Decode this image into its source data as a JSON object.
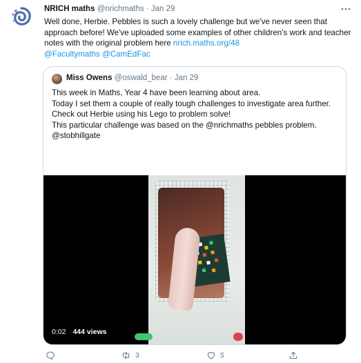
{
  "tweet": {
    "author_name": "NRICH maths",
    "author_handle": "@nrichmaths",
    "separator": " · ",
    "date": "Jan 29",
    "more_icon": "more-horizontal-icon",
    "text_before_link": "Well done, Herbie. Pebbles is such a lovely challenge but we've never seen that approach before! We've uploaded some examples of other children's work and teacher notes with the original problem here ",
    "link": "nrich.maths.org/48",
    "mention1": "@Facultymaths",
    "mention2": "@CamEdFac"
  },
  "quoted": {
    "author_name": "Miss Owens",
    "author_handle": "@oswald_bear",
    "date": "Jan 29",
    "lines": [
      "This week in Maths, Year 4 have been learning about area.",
      "Today I set them a couple of really tough challenges to investigate area further.",
      "Check out Herbie using his Lego to problem solve!",
      "This particular challenge was based on the @nrichmaths pebbles problem.",
      "@stobhillgate"
    ],
    "video": {
      "time": "0:02",
      "views": "444 views"
    }
  },
  "actions": {
    "reply_icon": "reply-icon",
    "retweet_icon": "retweet-icon",
    "retweet_count": "3",
    "like_icon": "heart-icon",
    "like_count": "5",
    "share_icon": "share-icon"
  },
  "colors": {
    "link": "#1b95e0",
    "meta": "#657786",
    "border": "#cfd9de"
  }
}
